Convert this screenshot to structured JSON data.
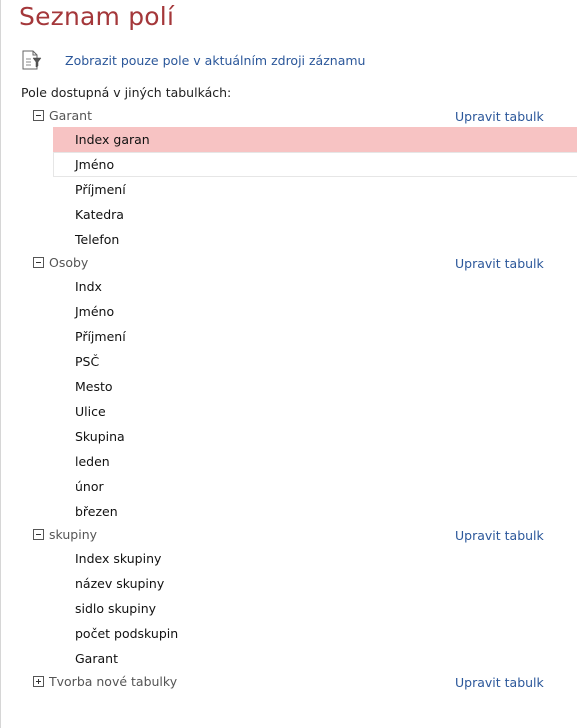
{
  "pane": {
    "title": "Seznam polí",
    "filter_link": "Zobrazit pouze pole v aktuálním zdroji záznamu",
    "filter_icon": "filter-table-icon",
    "section_label": "Pole dostupná v jiných tabulkách:"
  },
  "colors": {
    "title": "#a4373a",
    "link": "#2b579a",
    "selected_row": "#f7c3c3"
  },
  "groups": [
    {
      "name": "Garant",
      "edit_label": "Upravit tabulk",
      "expanded": true,
      "fields": [
        "Index garan",
        "Jméno",
        "Příjmení",
        "Katedra",
        "Telefon"
      ]
    },
    {
      "name": "Osoby",
      "edit_label": "Upravit tabulk",
      "expanded": true,
      "fields": [
        "Indx",
        "Jméno",
        "Příjmení",
        "PSČ",
        "Mesto",
        "Ulice",
        "Skupina",
        "leden",
        "únor",
        "březen"
      ]
    },
    {
      "name": "skupiny",
      "edit_label": "Upravit tabulk",
      "expanded": true,
      "fields": [
        "Index skupiny",
        "název skupiny",
        "sidlo skupiny",
        "počet podskupin",
        "Garant"
      ]
    },
    {
      "name": "Tvorba nové tabulky",
      "edit_label": "Upravit tabulk",
      "expanded": false,
      "fields": []
    }
  ],
  "selection": {
    "group": 0,
    "field": 0
  },
  "focus": {
    "group": 0,
    "field": 1
  }
}
